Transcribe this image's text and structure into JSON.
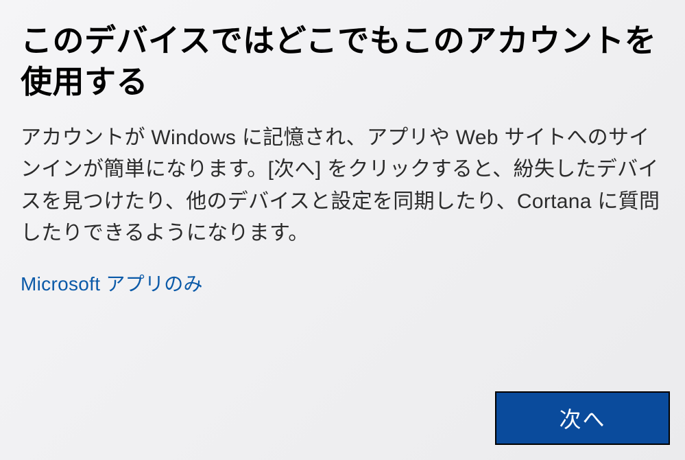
{
  "dialog": {
    "heading": "このデバイスではどこでもこのアカウントを使用する",
    "description": "アカウントが Windows に記憶され、アプリや Web サイトへのサインインが簡単になります。[次へ] をクリックすると、紛失したデバイスを見つけたり、他のデバイスと設定を同期したり、Cortana に質問したりできるようになります。",
    "link_label": "Microsoft アプリのみ",
    "next_label": "次へ"
  }
}
